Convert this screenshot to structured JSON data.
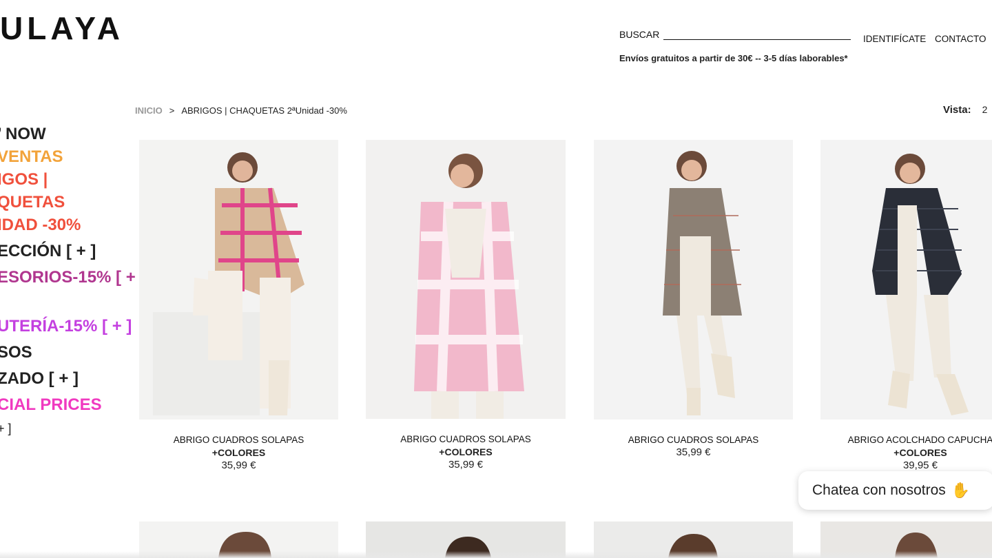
{
  "header": {
    "logo_text": "ULAYA",
    "search_label": "BUSCAR",
    "search_value": "",
    "login_link": "IDENTIFÍCATE",
    "contact_link": "CONTACTO",
    "shipping_notice": "Envíos gratuitos a partir de 30€ -- 3-5 días laborables*"
  },
  "breadcrumb": {
    "home": "INICIO",
    "separator": ">",
    "current": "ABRIGOS | CHAQUETAS 2ªUnidad -30%"
  },
  "view": {
    "label": "Vista:",
    "value": "2"
  },
  "sidebar": {
    "items": [
      {
        "label": "’ NOW",
        "color": "#222222"
      },
      {
        "label": "VENTAS",
        "color": "#f2a33a"
      },
      {
        "label": "IGOS |",
        "color": "#f0503c"
      },
      {
        "label": "QUETAS",
        "color": "#f0503c"
      },
      {
        "label": "IDAD -30%",
        "color": "#f0503c"
      },
      {
        "label": "ECCIÓN [ + ]",
        "color": "#222222"
      },
      {
        "label": "ESORIOS-15% [ +",
        "color": "#b0368f"
      },
      {
        "label": "",
        "color": "#b0368f"
      },
      {
        "label": "UTERÍA-15% [ + ]",
        "color": "#c440e0"
      },
      {
        "label": "SOS",
        "color": "#222222"
      },
      {
        "label": "ZADO [ + ]",
        "color": "#222222"
      },
      {
        "label": "CIAL PRICES",
        "color": "#f03ac0"
      },
      {
        "label": "+ ]",
        "color": "#222222"
      }
    ]
  },
  "products": [
    {
      "name": "ABRIGO CUADROS SOLAPAS",
      "subtitle": "+COLORES",
      "price": "35,99 €",
      "coat_color": "#e9b9c4",
      "accent": "#e0458a"
    },
    {
      "name": "ABRIGO CUADROS SOLAPAS",
      "subtitle": "+COLORES",
      "price": "35,99 €",
      "coat_color": "#f0b4c8",
      "accent": "#e07fa0"
    },
    {
      "name": "ABRIGO CUADROS SOLAPAS",
      "subtitle": "",
      "price": "35,99 €",
      "coat_color": "#8a7d70",
      "accent": "#5c5248"
    },
    {
      "name": "ABRIGO ACOLCHADO CAPUCHA",
      "subtitle": "+COLORES",
      "price": "39,95 €",
      "coat_color": "#2a2e38",
      "accent": "#1a1d24"
    }
  ],
  "chat": {
    "label": "Chatea con nosotros",
    "icon": "waving-hand-icon"
  }
}
